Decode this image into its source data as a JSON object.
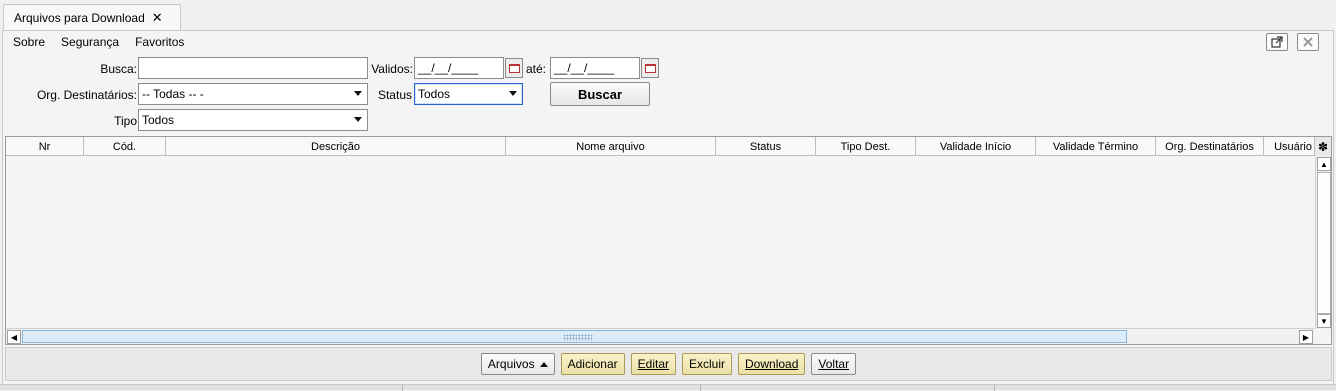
{
  "tab": {
    "title": "Arquivos para Download",
    "close_glyph": "✕"
  },
  "menu": {
    "items": [
      "Sobre",
      "Segurança",
      "Favoritos"
    ]
  },
  "window_controls": {
    "popout_icon": "external-window-icon",
    "close_icon": "close-icon"
  },
  "form": {
    "busca_label": "Busca:",
    "busca_value": "",
    "validos_label": "Validos:",
    "validos_from": "__/__/____",
    "ate_label": "até:",
    "validos_to": "__/__/____",
    "org_label": "Org. Destinatários:",
    "org_value": "-- Todas -- -",
    "status_label": "Status",
    "status_value": "Todos",
    "tipo_label": "Tipo",
    "tipo_value": "Todos",
    "buscar_label": "Buscar"
  },
  "table": {
    "columns": [
      "Nr",
      "Cód.",
      "Descrição",
      "Nome arquivo",
      "Status",
      "Tipo Dest.",
      "Validade Início",
      "Validade Término",
      "Org. Destinatários",
      "Usuário"
    ],
    "rows": []
  },
  "footer": {
    "arquivos": "Arquivos",
    "adicionar": "Adicionar",
    "editar": "Editar",
    "excluir": "Excluir",
    "download": "Download",
    "voltar": "Voltar"
  },
  "colors": {
    "accent_yellow": "#ece0a8",
    "focus_blue": "#2a64c8",
    "scroll_thumb": "#dcecf8"
  }
}
